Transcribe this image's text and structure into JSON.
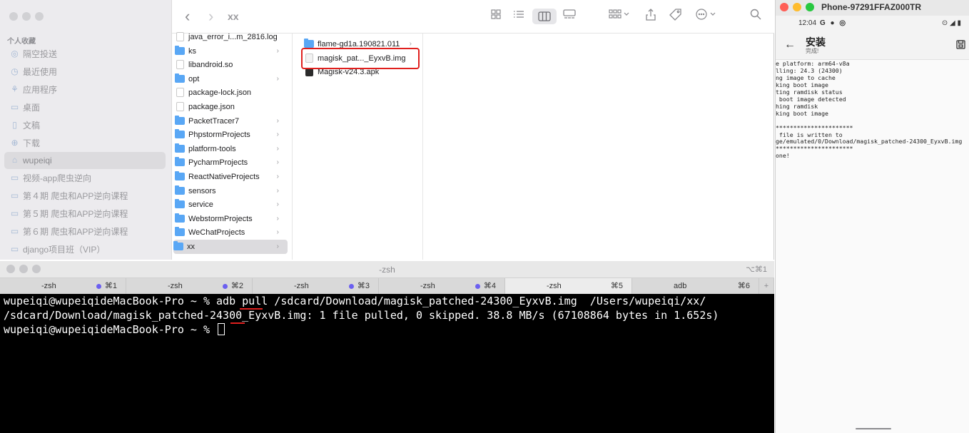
{
  "finder": {
    "sidebar": {
      "section_label": "个人收藏",
      "items": [
        {
          "icon": "airdrop-icon",
          "glyph": "◎",
          "label": "隔空投送",
          "selected": false
        },
        {
          "icon": "clock-icon",
          "glyph": "◷",
          "label": "最近使用",
          "selected": false
        },
        {
          "icon": "apps-icon",
          "glyph": "⚘",
          "label": "应用程序",
          "selected": false
        },
        {
          "icon": "desktop-icon",
          "glyph": "▭",
          "label": "桌面",
          "selected": false
        },
        {
          "icon": "document-icon",
          "glyph": "▯",
          "label": "文稿",
          "selected": false
        },
        {
          "icon": "download-icon",
          "glyph": "⊕",
          "label": "下载",
          "selected": false
        },
        {
          "icon": "home-icon",
          "glyph": "⌂",
          "label": "wupeiqi",
          "selected": true
        },
        {
          "icon": "folder-icon",
          "glyph": "▭",
          "label": "视频-app爬虫逆向",
          "selected": false
        },
        {
          "icon": "folder-icon",
          "glyph": "▭",
          "label": "第４期 爬虫和APP逆向课程",
          "selected": false
        },
        {
          "icon": "folder-icon",
          "glyph": "▭",
          "label": "第５期 爬虫和APP逆向课程",
          "selected": false
        },
        {
          "icon": "folder-icon",
          "glyph": "▭",
          "label": "第６期 爬虫和APP逆向课程",
          "selected": false
        },
        {
          "icon": "folder-icon",
          "glyph": "▭",
          "label": "django项目班（VIP）",
          "selected": false
        }
      ]
    },
    "toolbar": {
      "back": "‹",
      "forward": "›",
      "title": "xx",
      "search_glyph": "⌕"
    },
    "column1": [
      {
        "name": "java_error_i...m_2816.log",
        "kind": "doc",
        "arrow": false
      },
      {
        "name": "ks",
        "kind": "folder",
        "arrow": true
      },
      {
        "name": "libandroid.so",
        "kind": "doc",
        "arrow": false
      },
      {
        "name": "opt",
        "kind": "folder",
        "arrow": true
      },
      {
        "name": "package-lock.json",
        "kind": "doc",
        "arrow": false
      },
      {
        "name": "package.json",
        "kind": "doc",
        "arrow": false
      },
      {
        "name": "PacketTracer7",
        "kind": "folder",
        "arrow": true
      },
      {
        "name": "PhpstormProjects",
        "kind": "folder",
        "arrow": true
      },
      {
        "name": "platform-tools",
        "kind": "folder",
        "arrow": true
      },
      {
        "name": "PycharmProjects",
        "kind": "folder",
        "arrow": true
      },
      {
        "name": "ReactNativeProjects",
        "kind": "folder",
        "arrow": true
      },
      {
        "name": "sensors",
        "kind": "folder",
        "arrow": true
      },
      {
        "name": "service",
        "kind": "folder",
        "arrow": true
      },
      {
        "name": "WebstormProjects",
        "kind": "folder",
        "arrow": true
      },
      {
        "name": "WeChatProjects",
        "kind": "folder",
        "arrow": true
      },
      {
        "name": "xx",
        "kind": "folder",
        "arrow": true,
        "selected": true
      }
    ],
    "column2": [
      {
        "name": "flame-gd1a.190821.011",
        "kind": "folder",
        "arrow": true
      },
      {
        "name": "magisk_pat..._EyxvB.img",
        "kind": "img",
        "arrow": false,
        "highlighted": true
      },
      {
        "name": "Magisk-v24.3.apk",
        "kind": "apk",
        "arrow": false
      }
    ],
    "highlight_color": "#e0201e"
  },
  "terminal": {
    "title": "-zsh",
    "shortcut": "⌥⌘1",
    "tabs": [
      {
        "label": "-zsh",
        "shortcut": "⌘1",
        "active": false,
        "dot": true
      },
      {
        "label": "-zsh",
        "shortcut": "⌘2",
        "active": false,
        "dot": true
      },
      {
        "label": "-zsh",
        "shortcut": "⌘3",
        "active": false,
        "dot": true
      },
      {
        "label": "-zsh",
        "shortcut": "⌘4",
        "active": false,
        "dot": true
      },
      {
        "label": "-zsh",
        "shortcut": "⌘5",
        "active": true,
        "dot": false
      },
      {
        "label": "adb",
        "shortcut": "⌘6",
        "active": false,
        "dot": false
      }
    ],
    "new_tab": "+",
    "lines": [
      "wupeiqi@wupeiqideMacBook-Pro ~ % adb pull /sdcard/Download/magisk_patched-24300_EyxvB.img  /Users/wupeiqi/xx/",
      "/sdcard/Download/magisk_patched-24300_EyxvB.img: 1 file pulled, 0 skipped. 38.8 MB/s (67108864 bytes in 1.652s)",
      "wupeiqi@wupeiqideMacBook-Pro ~ % "
    ]
  },
  "phone": {
    "window_title": "Phone-97291FFAZ000TR",
    "time": "12:04",
    "status_icons": "G ● ◎",
    "right_status": "⊙ ◢ ▮",
    "app_title": "安装",
    "app_subtitle": "完成!",
    "log": [
      "e platform: arm64-v8a",
      "lling: 24.3 (24300)",
      "ng image to cache",
      "king boot image",
      "ting ramdisk status",
      " boot image detected",
      "hing ramdisk",
      "king boot image",
      "",
      "**********************",
      " file is written to",
      "ge/emulated/0/Download/magisk_patched-24300_EyxvB.img",
      "**********************",
      "one!"
    ]
  }
}
